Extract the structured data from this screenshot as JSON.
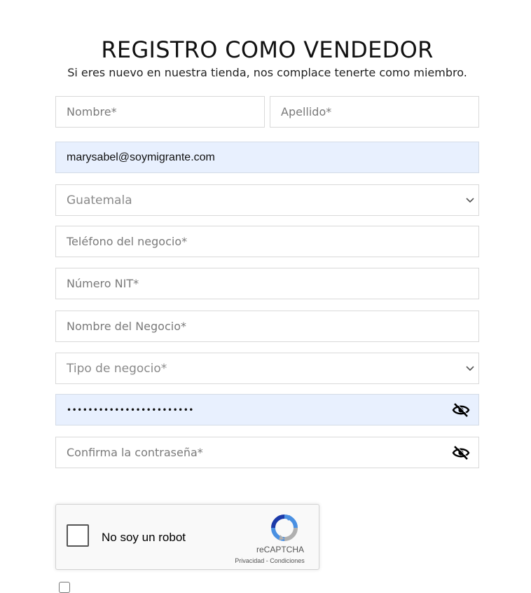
{
  "header": {
    "title": "REGISTRO COMO VENDEDOR",
    "subtitle": "Si eres nuevo en nuestra tienda, nos complace tenerte como miembro."
  },
  "form": {
    "first_name": {
      "placeholder": "Nombre*",
      "value": ""
    },
    "last_name": {
      "placeholder": "Apellido*",
      "value": ""
    },
    "email": {
      "value": "marysabel@soymigrante.com"
    },
    "country": {
      "selected": "Guatemala"
    },
    "business_phone": {
      "placeholder": "Teléfono del negocio*",
      "value": ""
    },
    "nit_number": {
      "placeholder": "Número NIT*",
      "value": ""
    },
    "business_name": {
      "placeholder": "Nombre del Negocio*",
      "value": ""
    },
    "business_type": {
      "selected": "Tipo de negocio*"
    },
    "password": {
      "masked": "••••••••••••••••••••••••"
    },
    "confirm_password": {
      "placeholder": "Confirma la contraseña*",
      "value": ""
    }
  },
  "captcha": {
    "label": "No soy un robot",
    "brand": "reCAPTCHA",
    "terms": "Privacidad - Condiciones"
  },
  "icons": {
    "select_arrow": "chevron-down-icon",
    "password_toggle": "eye-slash-icon",
    "captcha_logo": "recaptcha-logo-icon"
  },
  "colors": {
    "autofill_bg": "#e8f0fe",
    "field_border": "#d9d9d9",
    "placeholder": "#7a7a7a",
    "recaptcha_blue": "#4a90e2",
    "recaptcha_gray": "#b0b0b0"
  }
}
